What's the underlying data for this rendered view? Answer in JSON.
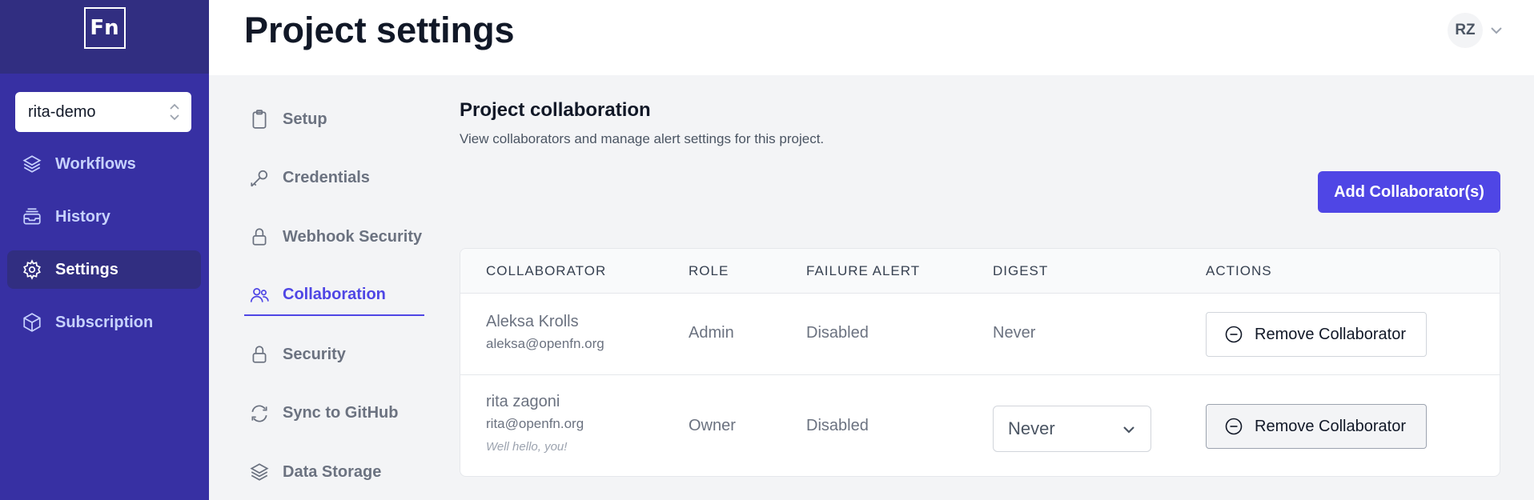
{
  "app": {
    "logo_text": "Fn",
    "project_name": "rita-demo"
  },
  "sidebar": {
    "items": [
      {
        "label": "Workflows",
        "icon": "layers-icon"
      },
      {
        "label": "History",
        "icon": "inbox-stack-icon"
      },
      {
        "label": "Settings",
        "icon": "gear-icon",
        "active": true
      },
      {
        "label": "Subscription",
        "icon": "cube-icon"
      }
    ]
  },
  "header": {
    "title": "Project settings",
    "user_initials": "RZ"
  },
  "settings_nav": {
    "items": [
      {
        "label": "Setup",
        "icon": "clipboard-icon"
      },
      {
        "label": "Credentials",
        "icon": "key-icon"
      },
      {
        "label": "Webhook Security",
        "icon": "lock-icon"
      },
      {
        "label": "Collaboration",
        "icon": "users-icon",
        "active": true
      },
      {
        "label": "Security",
        "icon": "lock-icon"
      },
      {
        "label": "Sync to GitHub",
        "icon": "refresh-icon"
      },
      {
        "label": "Data Storage",
        "icon": "stack-icon"
      }
    ]
  },
  "main": {
    "title": "Project collaboration",
    "description": "View collaborators and manage alert settings for this project.",
    "add_button": "Add Collaborator(s)",
    "table": {
      "headers": [
        "COLLABORATOR",
        "ROLE",
        "FAILURE ALERT",
        "DIGEST",
        "ACTIONS"
      ],
      "rows": [
        {
          "name": "Aleksa Krolls",
          "email": "aleksa@openfn.org",
          "note": "",
          "role": "Admin",
          "failure_alert": "Disabled",
          "digest": "Never",
          "action": "Remove Collaborator"
        },
        {
          "name": "rita zagoni",
          "email": "rita@openfn.org",
          "note": "Well hello, you!",
          "role": "Owner",
          "failure_alert": "Disabled",
          "digest": "Never",
          "action": "Remove Collaborator"
        }
      ]
    }
  },
  "colors": {
    "sidebar_bg": "#3730a3",
    "sidebar_top": "#312e81",
    "accent": "#4f46e5"
  }
}
